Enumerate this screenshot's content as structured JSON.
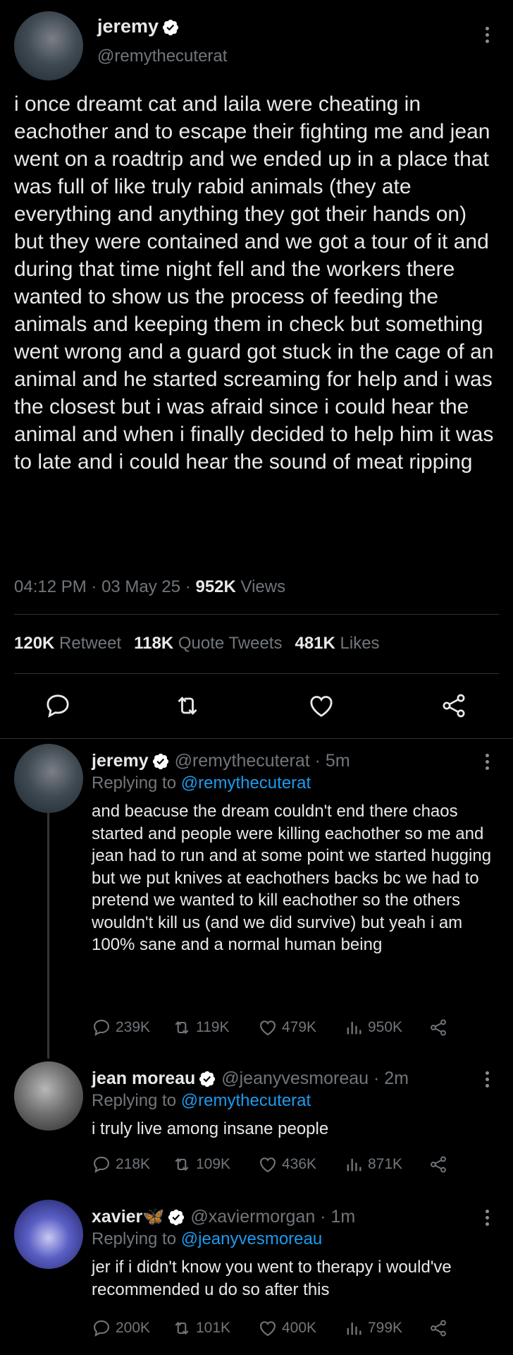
{
  "main_tweet": {
    "name": "jeremy",
    "handle": "@remythecuterat",
    "text": "i once dreamt cat and laila were cheating in eachother and to escape their fighting me and jean went on a roadtrip and we ended up in a place that was full of like truly rabid animals (they ate everything and anything they got their hands on) but they were contained and we got a tour of it and during that time night fell and the workers there wanted to show us the process of feeding the animals and keeping them in check but something went wrong and a guard got stuck in the cage of an animal and he started screaming for help and i was the closest but i was afraid since i could hear the animal and when i finally decided to help him it was to late and i could hear the sound of meat ripping",
    "time": "04:12 PM",
    "date": "03 May 25",
    "views_count": "952K",
    "views_label": "Views",
    "retweets_count": "120K",
    "retweets_label": "Retweet",
    "quotes_count": "118K",
    "quotes_label": "Quote Tweets",
    "likes_count": "481K",
    "likes_label": "Likes"
  },
  "replies": [
    {
      "name": "jeremy",
      "handle": "@remythecuterat",
      "age": "5m",
      "replying_prefix": "Replying to",
      "replying_to": "@remythecuterat",
      "text": "and beacuse the dream couldn't end there chaos started and people were killing eachother so me and jean had to run and at some point we started hugging but we put knives at eachothers backs bc we had to pretend we wanted to kill eachother so the others wouldn't kill us (and we did survive) but yeah i am 100% sane and a normal human being",
      "replies": "239K",
      "retweets": "119K",
      "likes": "479K",
      "views": "950K"
    },
    {
      "name": "jean moreau",
      "handle": "@jeanyvesmoreau",
      "age": "2m",
      "replying_prefix": "Replying to",
      "replying_to": "@remythecuterat",
      "text": "i truly live among insane people",
      "replies": "218K",
      "retweets": "109K",
      "likes": "436K",
      "views": "871K"
    },
    {
      "name": "xavier",
      "name_emoji": "🦋",
      "handle": "@xaviermorgan",
      "age": "1m",
      "replying_prefix": "Replying to",
      "replying_to": "@jeanyvesmoreau",
      "text": "jer if i didn't know you went to therapy i would've recommended u do so after this",
      "replies": "200K",
      "retweets": "101K",
      "likes": "400K",
      "views": "799K"
    }
  ],
  "colors": {
    "accent": "#1d9bf0",
    "muted": "#71767b",
    "text": "#e7e9ea",
    "background": "#000000"
  }
}
